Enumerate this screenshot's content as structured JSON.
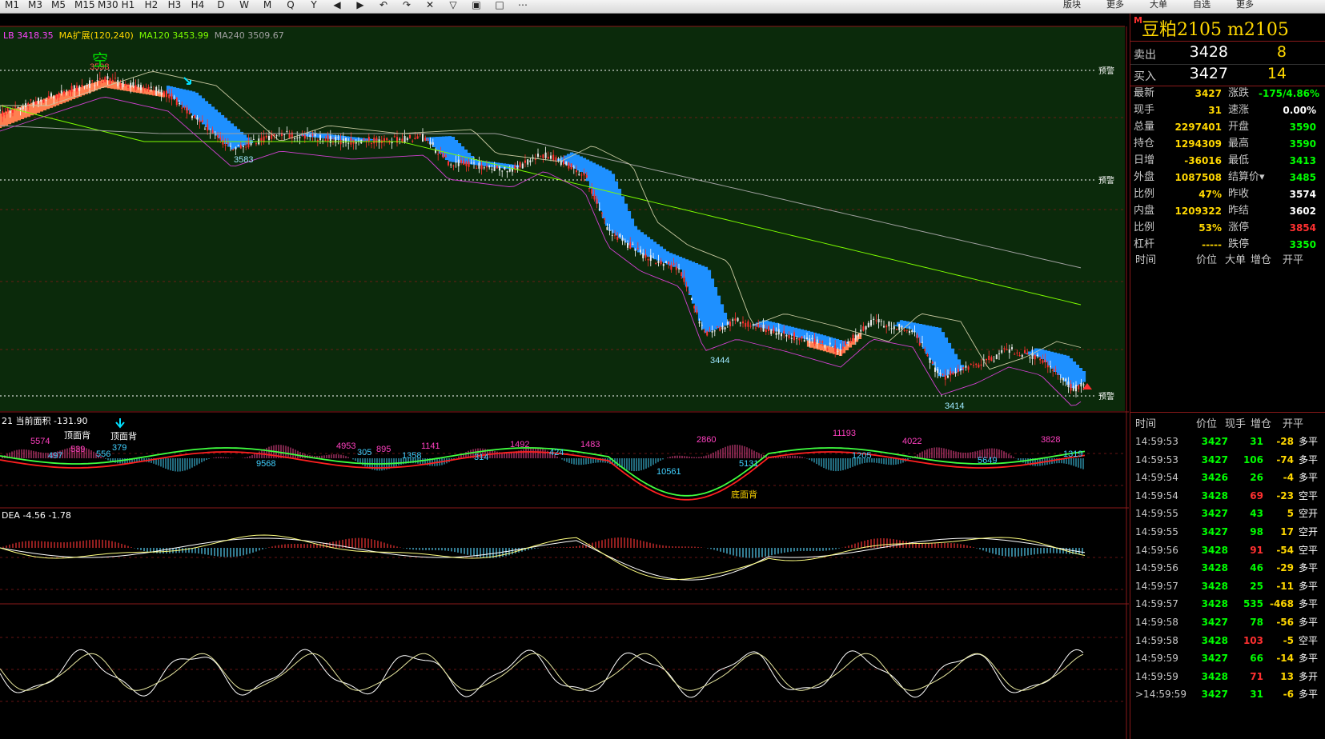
{
  "toolbar": {
    "items": [
      "M1",
      "M3",
      "M5",
      "M15",
      "M30",
      "H1",
      "H2",
      "H3",
      "H4",
      "D",
      "W",
      "M",
      "Q",
      "Y",
      "◀",
      "▶",
      "↶",
      "↷",
      "✕",
      "▽",
      "▣",
      "□",
      "⋯"
    ],
    "right_items": [
      "版块",
      "更多",
      "大单",
      "自选",
      "更多"
    ]
  },
  "chart": {
    "main_label": "LB 3418.35  MA扩展(120,240)  MA120 3453.99  MA240 3509.67",
    "main_label_parts": {
      "lb": "LB 3418.35",
      "ext": "MA扩展(120,240)",
      "ma120": "MA120 3453.99",
      "ma240": "MA240 3509.67"
    },
    "price_annotations": [
      "3598",
      "3583",
      "3444",
      "3414"
    ],
    "alert_labels": [
      "预警",
      "预警",
      "预警"
    ],
    "signal_glyph": "空",
    "sub1_label": "21  当前面积 -131.90",
    "sub1_numbers_magenta": [
      "5574",
      "539",
      "4953",
      "895",
      "1141",
      "1492",
      "1483",
      "2860",
      "11193",
      "4022",
      "3828"
    ],
    "sub1_numbers_cyan": [
      "497",
      "556",
      "379",
      "9568",
      "305",
      "1358",
      "314",
      "424",
      "10561",
      "5131",
      "1205",
      "5649",
      "1319"
    ],
    "sub1_text_labels": [
      "顶面背",
      "顶面背",
      "底面背"
    ],
    "sub2_label": "DEA -4.56   -1.78",
    "colors": {
      "up": "#ff3030",
      "down": "#00ffff",
      "band_down": "#1e90ff",
      "band_up": "#ff7f50",
      "bg_main": "#0b2a0b",
      "grid": "#8b1a1a"
    }
  },
  "quote": {
    "symbol_mark": "M",
    "title": "豆粕2105  m2105",
    "sell": {
      "label": "卖出",
      "price": "3428",
      "vol": "8"
    },
    "buy": {
      "label": "买入",
      "price": "3427",
      "vol": "14"
    },
    "rows": [
      {
        "l1": "最新",
        "v1": "3427",
        "l2": "涨跌",
        "v2": "-175/4.86%",
        "c2": "#00ff00"
      },
      {
        "l1": "现手",
        "v1": "31",
        "l2": "速涨",
        "v2": "0.00%",
        "c2": "#ffffff"
      },
      {
        "l1": "总量",
        "v1": "2297401",
        "l2": "开盘",
        "v2": "3590",
        "c2": "#00ff00"
      },
      {
        "l1": "持仓",
        "v1": "1294309",
        "l2": "最高",
        "v2": "3590",
        "c2": "#00ff00"
      },
      {
        "l1": "日增",
        "v1": "-36016",
        "l2": "最低",
        "v2": "3413",
        "c2": "#00ff00"
      },
      {
        "l1": "外盘",
        "v1": "1087508",
        "l2": "结算价▾",
        "v2": "3485",
        "c2": "#00ff00"
      },
      {
        "l1": "比例",
        "v1": "47%",
        "l2": "昨收",
        "v2": "3574",
        "c2": "#ffffff"
      },
      {
        "l1": "内盘",
        "v1": "1209322",
        "l2": "昨结",
        "v2": "3602",
        "c2": "#ffffff"
      },
      {
        "l1": "比例",
        "v1": "53%",
        "l2": "涨停",
        "v2": "3854",
        "c2": "#ff3030"
      },
      {
        "l1": "杠杆",
        "v1": "-----",
        "l2": "跌停",
        "v2": "3350",
        "c2": "#00ff00"
      }
    ],
    "big_header": [
      "时间",
      "价位",
      "大单",
      "增仓",
      "开平"
    ],
    "tick_header": [
      "时间",
      "价位",
      "现手",
      "增仓",
      "开平"
    ],
    "ticks": [
      {
        "time": "14:59:53",
        "price": "3427",
        "vol": "31",
        "chg": "-28",
        "type": "多平",
        "pc": "#00ff00",
        "vc": "#00ff00"
      },
      {
        "time": "14:59:53",
        "price": "3427",
        "vol": "106",
        "chg": "-74",
        "type": "多平",
        "pc": "#00ff00",
        "vc": "#00ff00"
      },
      {
        "time": "14:59:54",
        "price": "3426",
        "vol": "26",
        "chg": "-4",
        "type": "多平",
        "pc": "#00ff00",
        "vc": "#00ff00"
      },
      {
        "time": "14:59:54",
        "price": "3428",
        "vol": "69",
        "chg": "-23",
        "type": "空平",
        "pc": "#00ff00",
        "vc": "#ff3030"
      },
      {
        "time": "14:59:55",
        "price": "3427",
        "vol": "43",
        "chg": "5",
        "type": "空开",
        "pc": "#00ff00",
        "vc": "#00ff00"
      },
      {
        "time": "14:59:55",
        "price": "3427",
        "vol": "98",
        "chg": "17",
        "type": "空开",
        "pc": "#00ff00",
        "vc": "#00ff00"
      },
      {
        "time": "14:59:56",
        "price": "3428",
        "vol": "91",
        "chg": "-54",
        "type": "空平",
        "pc": "#00ff00",
        "vc": "#ff3030"
      },
      {
        "time": "14:59:56",
        "price": "3428",
        "vol": "46",
        "chg": "-29",
        "type": "多平",
        "pc": "#00ff00",
        "vc": "#00ff00"
      },
      {
        "time": "14:59:57",
        "price": "3428",
        "vol": "25",
        "chg": "-11",
        "type": "多平",
        "pc": "#00ff00",
        "vc": "#00ff00"
      },
      {
        "time": "14:59:57",
        "price": "3428",
        "vol": "535",
        "chg": "-468",
        "type": "多平",
        "pc": "#00ff00",
        "vc": "#00ff00"
      },
      {
        "time": "14:59:58",
        "price": "3427",
        "vol": "78",
        "chg": "-56",
        "type": "多平",
        "pc": "#00ff00",
        "vc": "#00ff00"
      },
      {
        "time": "14:59:58",
        "price": "3428",
        "vol": "103",
        "chg": "-5",
        "type": "空平",
        "pc": "#00ff00",
        "vc": "#ff3030"
      },
      {
        "time": "14:59:59",
        "price": "3427",
        "vol": "66",
        "chg": "-14",
        "type": "多平",
        "pc": "#00ff00",
        "vc": "#00ff00"
      },
      {
        "time": "14:59:59",
        "price": "3428",
        "vol": "71",
        "chg": "13",
        "type": "多开",
        "pc": "#00ff00",
        "vc": "#ff3030"
      },
      {
        "time": ">14:59:59",
        "price": "3427",
        "vol": "31",
        "chg": "-6",
        "type": "多平",
        "pc": "#00ff00",
        "vc": "#00ff00"
      }
    ]
  }
}
